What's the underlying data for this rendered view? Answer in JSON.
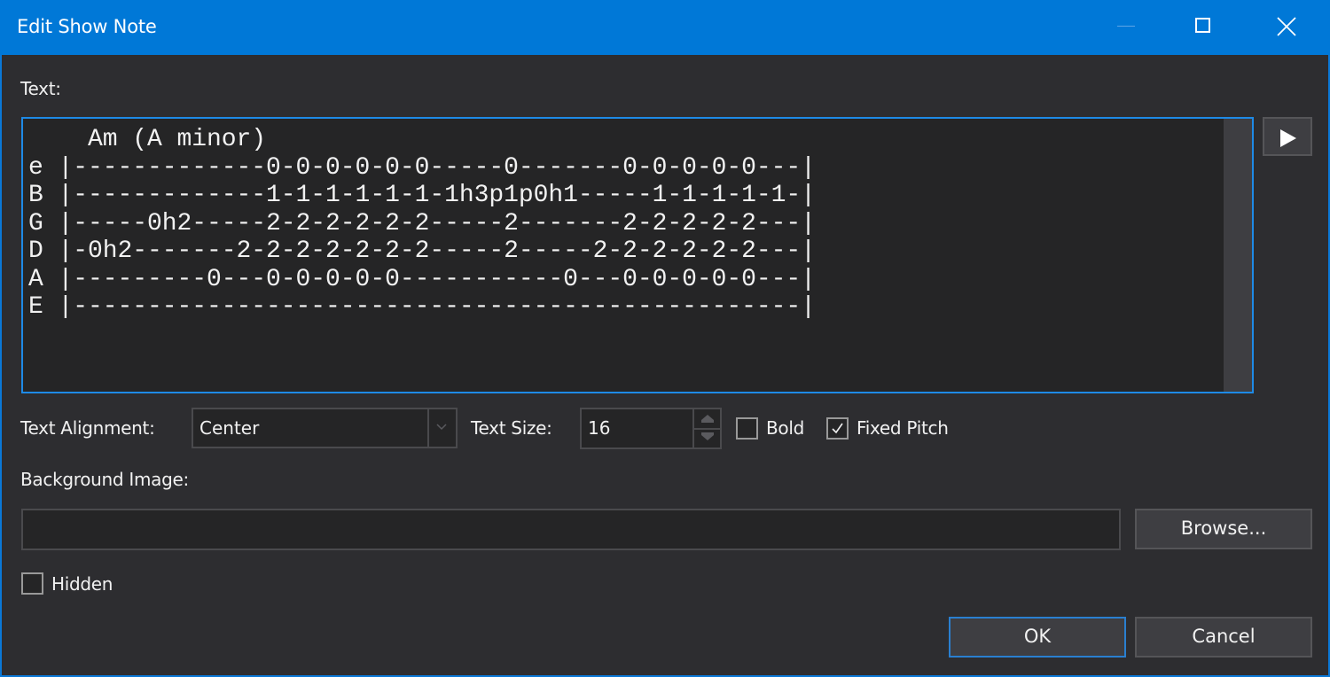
{
  "window": {
    "title": "Edit Show Note",
    "controls": [
      "minimize-icon",
      "maximize-icon",
      "close-icon"
    ]
  },
  "colors": {
    "accent": "#0078d7",
    "background": "#2d2d30",
    "field_background": "#252526",
    "button_background": "#3e3e42"
  },
  "text_section": {
    "label": "Text:",
    "content": "    Am (A minor)\ne |-------------0-0-0-0-0-0-----0-------0-0-0-0-0---|\nB |-------------1-1-1-1-1-1-1h3p1p0h1-----1-1-1-1-1-|\nG |-----0h2-----2-2-2-2-2-2-----2-------2-2-2-2-2---|\nD |-0h2-------2-2-2-2-2-2-2-----2-----2-2-2-2-2-2---|\nA |---------0---0-0-0-0-0-----------0---0-0-0-0-0---|\nE |-------------------------------------------------|",
    "play_button_icon": "play-icon"
  },
  "options": {
    "alignment_label": "Text Alignment:",
    "alignment_value": "Center",
    "size_label": "Text Size:",
    "size_value": "16",
    "bold_label": "Bold",
    "bold_checked": false,
    "fixed_pitch_label": "Fixed Pitch",
    "fixed_pitch_checked": true
  },
  "background_image": {
    "label": "Background Image:",
    "value": "",
    "browse_label": "Browse..."
  },
  "hidden": {
    "label": "Hidden",
    "checked": false
  },
  "footer": {
    "ok_label": "OK",
    "cancel_label": "Cancel"
  }
}
